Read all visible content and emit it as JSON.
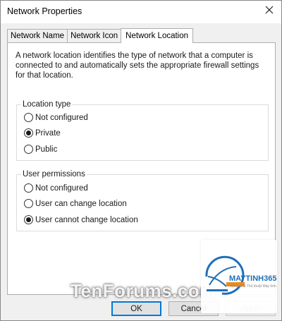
{
  "window": {
    "title": "Network Properties"
  },
  "tabs": [
    "Network Name",
    "Network Icon",
    "Network Location"
  ],
  "active_tab": "Network Location",
  "description": "A network location identifies the type of network that a computer is connected to and automatically sets the appropriate firewall settings for that location.",
  "location_type": {
    "label": "Location type",
    "options": [
      {
        "label": "Not configured",
        "selected": false
      },
      {
        "label": "Private",
        "selected": true
      },
      {
        "label": "Public",
        "selected": false
      }
    ]
  },
  "user_permissions": {
    "label": "User permissions",
    "options": [
      {
        "label": "Not configured",
        "selected": false
      },
      {
        "label": "User can change location",
        "selected": false
      },
      {
        "label": "User cannot change location",
        "selected": true
      }
    ]
  },
  "buttons": {
    "ok": "OK",
    "cancel": "Cancel",
    "apply": "Apply"
  },
  "watermarks": {
    "site": "TenForums.com",
    "logo_name": "MAYTINH365",
    "logo_tagline": "Chia sẻ & Thủ thuật Máy tính"
  },
  "colors": {
    "accent": "#0078d7",
    "logo_blue": "#1e6fb8",
    "logo_orange": "#f08a1c"
  }
}
